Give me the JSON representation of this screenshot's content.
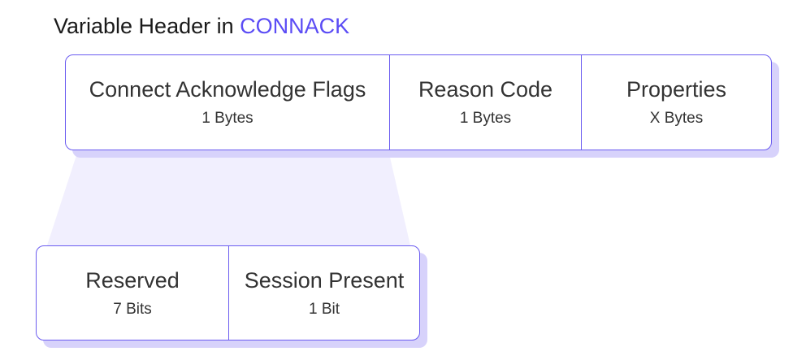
{
  "title": {
    "prefix": "Variable Header in ",
    "highlight": "CONNACK"
  },
  "colors": {
    "accent": "#5b4cf5",
    "border": "#6b5cf0",
    "shadow": "#d7d2fb",
    "funnel": "#f1effe"
  },
  "variable_header": [
    {
      "name": "Connect Acknowledge Flags",
      "size": "1 Bytes"
    },
    {
      "name": "Reason Code",
      "size": "1 Bytes"
    },
    {
      "name": "Properties",
      "size": "X Bytes"
    }
  ],
  "flags_breakdown": [
    {
      "name": "Reserved",
      "size": "7 Bits"
    },
    {
      "name": "Session Present",
      "size": "1 Bit"
    }
  ]
}
